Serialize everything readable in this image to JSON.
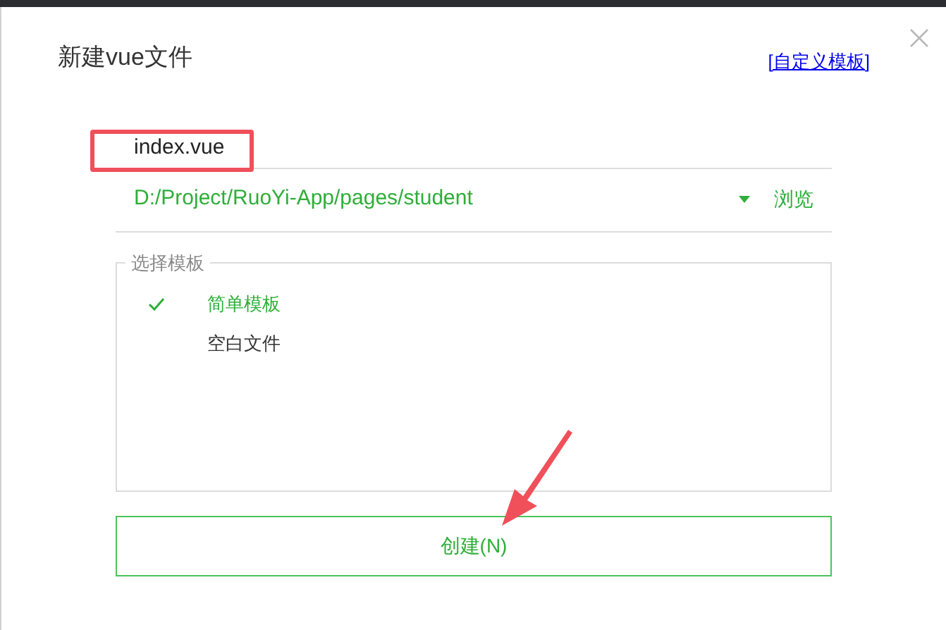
{
  "dialog": {
    "title": "新建vue文件",
    "custom_template_link": "[自定义模板]"
  },
  "file_name": {
    "value": "index.vue"
  },
  "directory": {
    "value": "D:/Project/RuoYi-App/pages/student",
    "browse": "浏览"
  },
  "templates": {
    "legend": "选择模板",
    "items": [
      {
        "label": "简单模板",
        "selected": true
      },
      {
        "label": "空白文件",
        "selected": false
      }
    ]
  },
  "create_button": "创建(N)"
}
